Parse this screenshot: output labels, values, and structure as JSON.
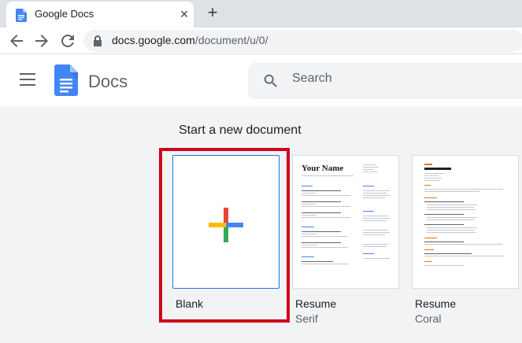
{
  "browser": {
    "tab_title": "Google Docs",
    "tab_close_symbol": "×",
    "new_tab_symbol": "+",
    "url_host": "docs.google.com",
    "url_path": "/document/u/0/"
  },
  "header": {
    "app_name": "Docs",
    "search_placeholder": "Search"
  },
  "templates": {
    "section_title": "Start a new document",
    "items": [
      {
        "title": "Blank",
        "subtitle": ""
      },
      {
        "title": "Resume",
        "subtitle": "Serif",
        "preview_heading": "Your Name"
      },
      {
        "title": "Resume",
        "subtitle": "Coral"
      }
    ]
  },
  "colors": {
    "docs_blue": "#4285f4",
    "plus_red": "#ea4335",
    "plus_blue": "#4285f4",
    "plus_green": "#34a853",
    "plus_yellow": "#fbbc04",
    "highlight": "#d0021b",
    "coral_accent": "#e8710a"
  }
}
